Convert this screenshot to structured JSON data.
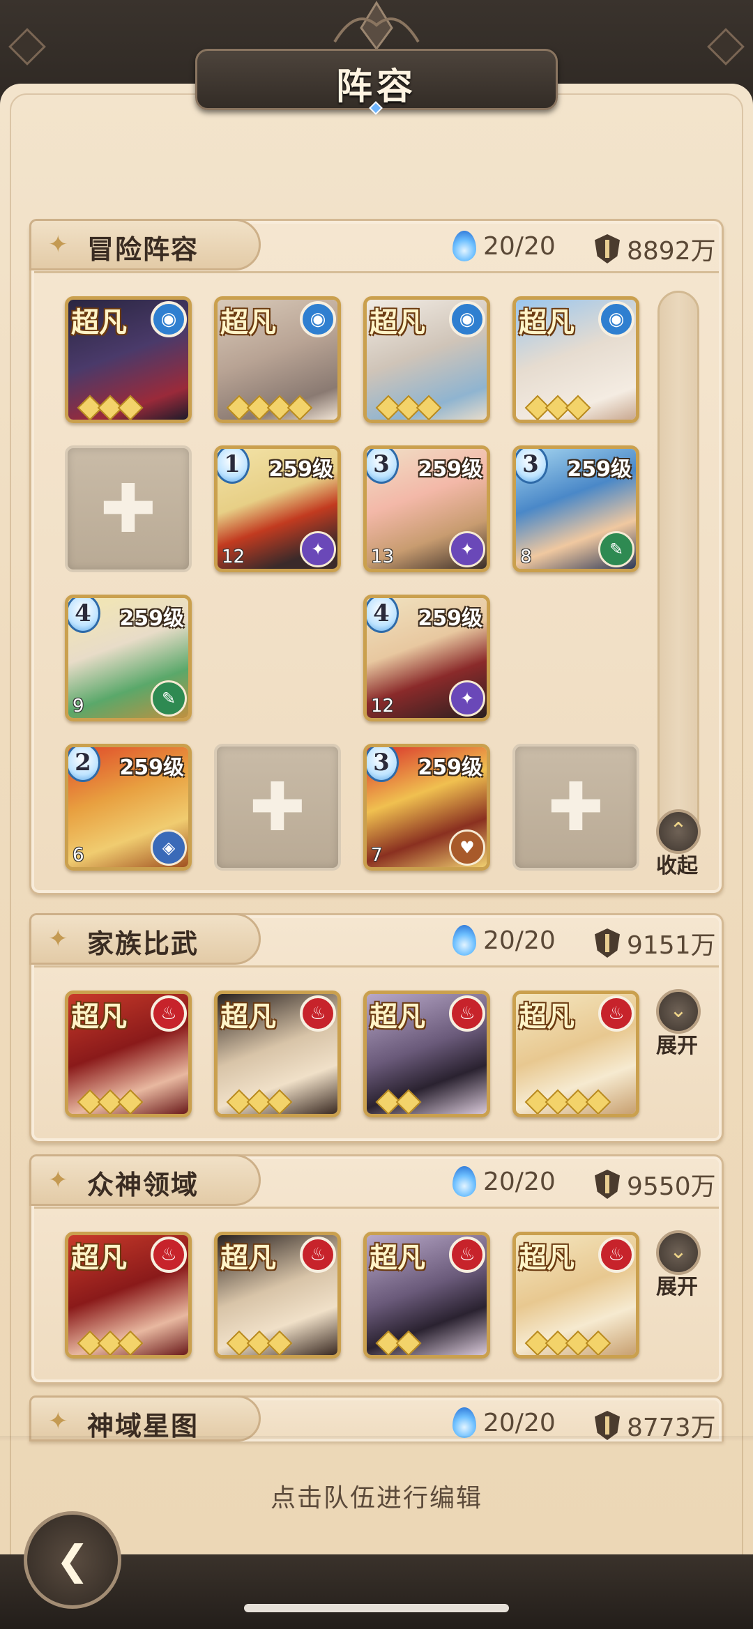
{
  "header": {
    "title": "阵容"
  },
  "panels": [
    {
      "title": "冒险阵容",
      "energy": "20/20",
      "power": "8892万",
      "toggle_label": "收起"
    },
    {
      "title": "家族比武",
      "energy": "20/20",
      "power": "9151万",
      "toggle_label": "展开"
    },
    {
      "title": "众神领域",
      "energy": "20/20",
      "power": "9550万",
      "toggle_label": "展开"
    },
    {
      "title": "神域星图",
      "energy": "20/20",
      "power": "8773万"
    }
  ],
  "tier_label": "超凡",
  "levels": {
    "r1c2": "259级",
    "r1c3": "259级",
    "r1c4": "259级",
    "r2c1": "259级",
    "r2c3": "259级",
    "r3c1": "259级",
    "r3c3": "259级"
  },
  "ranks": {
    "r1c2": "1",
    "r1c3": "3",
    "r1c4": "3",
    "r2c1": "4",
    "r2c3": "4",
    "r3c1": "2",
    "r3c3": "3"
  },
  "counts": {
    "r1c2": "12",
    "r1c3": "13",
    "r1c4": "8",
    "r2c1": "9",
    "r2c3": "12",
    "r3c1": "6",
    "r3c3": "7"
  },
  "footer": {
    "hint": "点击队伍进行编辑"
  },
  "colors": {
    "water_elem": "#2f7fd0",
    "fire_elem": "#c7232b",
    "frame_gold": "#caa04e",
    "panel_bg": "#f3e4cc"
  }
}
